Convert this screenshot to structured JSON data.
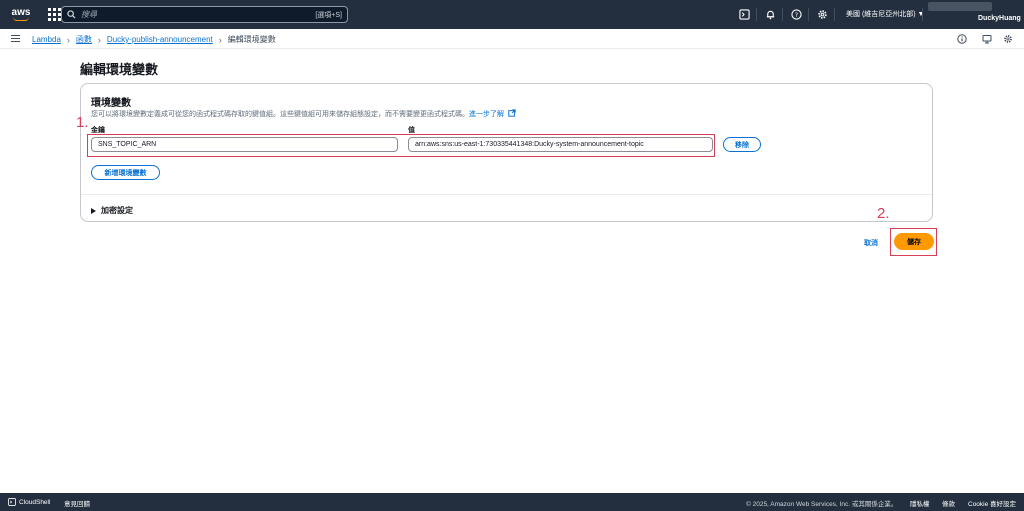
{
  "topnav": {
    "logo_text": "aws",
    "search_placeholder": "搜尋",
    "search_shortcut": "[選項+S]",
    "region": "美國 (維吉尼亞州北部) ▼",
    "user": "DuckyHuang"
  },
  "breadcrumb": {
    "items": [
      "Lambda",
      "函數",
      "Ducky-publish-announcement"
    ],
    "current": "編輯環境變數"
  },
  "page": {
    "title": "編輯環境變數"
  },
  "panel": {
    "title": "環境變數",
    "description": "您可以將環境變數定義成可從您的函式程式碼存取的鍵值組。這些鍵值組可用來儲存組態設定，而不需要變更函式程式碼。",
    "learn_more": "進一步了解",
    "key_label": "金鑰",
    "value_label": "值",
    "key_value": "SNS_TOPIC_ARN",
    "value_value": "arn:aws:sns:us-east-1:730335441348:Ducky-system-announcement-topic",
    "remove_label": "移除",
    "add_label": "新增環境變數",
    "encryption_label": "加密設定"
  },
  "annotations": {
    "one": "1.",
    "two": "2."
  },
  "actions": {
    "cancel": "取消",
    "save": "儲存"
  },
  "footer": {
    "cloudshell": "CloudShell",
    "feedback": "意見回饋",
    "copyright": "© 2025, Amazon Web Services, Inc. 或其關係企業。",
    "privacy": "隱私權",
    "terms": "條款",
    "cookie": "Cookie 喜好設定"
  },
  "colors": {
    "nav_bg": "#232f3e",
    "accent_orange": "#ff9900",
    "link_blue": "#0972d3",
    "annotation_red": "#d63f56"
  }
}
